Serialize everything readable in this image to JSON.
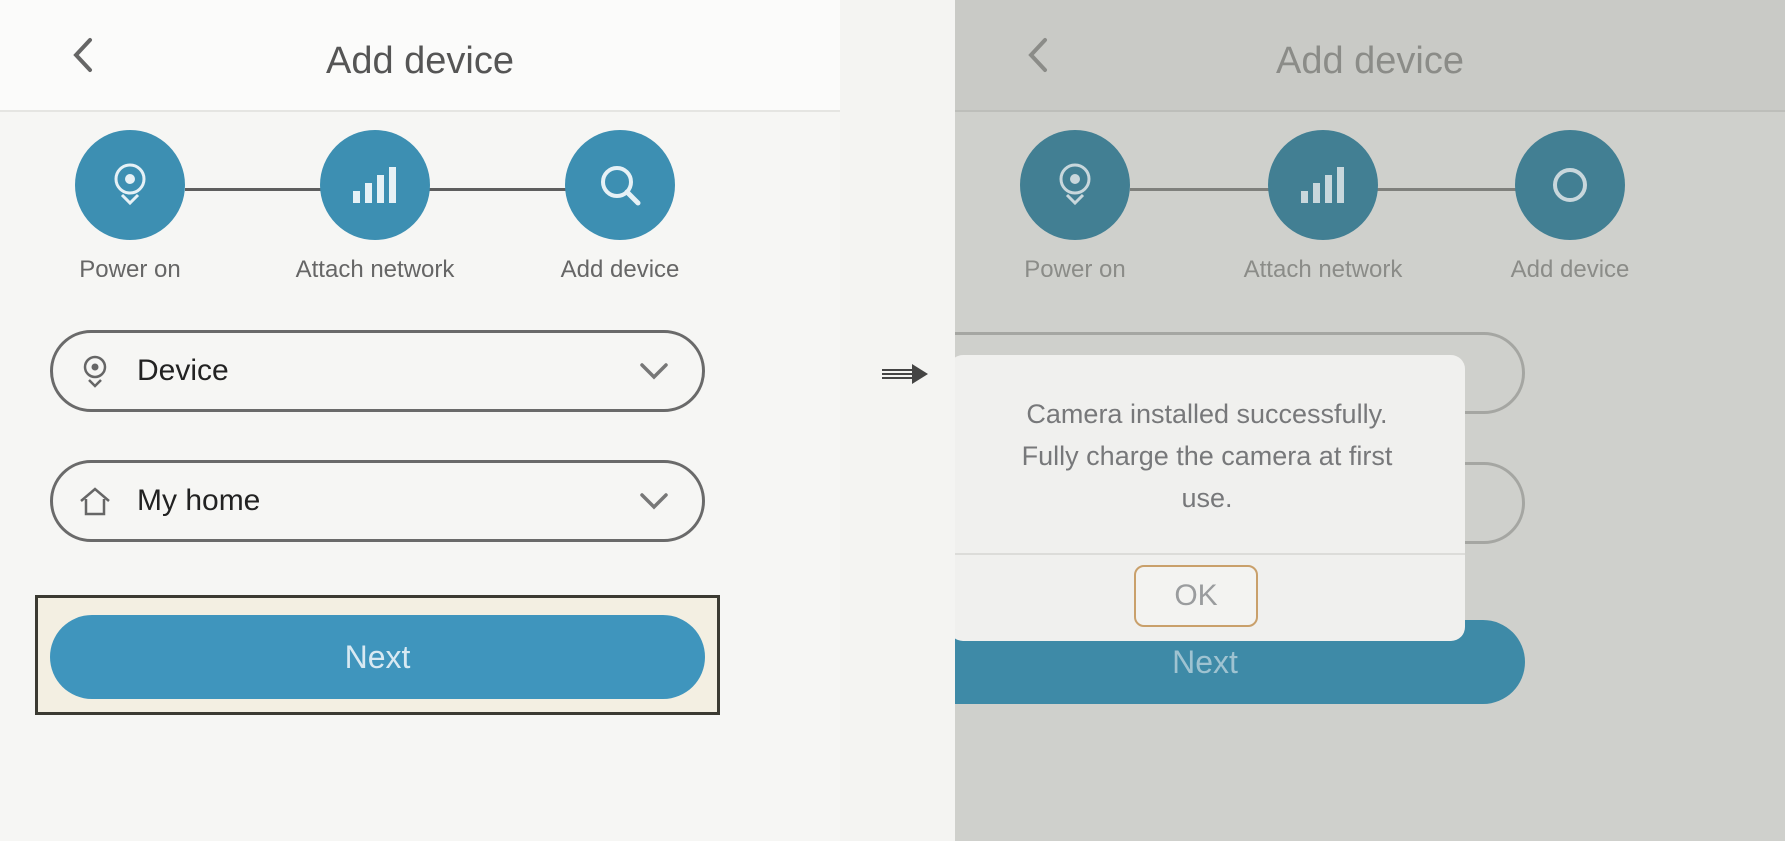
{
  "screens": [
    {
      "title": "Add device",
      "steps": [
        {
          "label": "Power on",
          "icon": "camera-icon"
        },
        {
          "label": "Attach network",
          "icon": "wifi-signal-icon"
        },
        {
          "label": "Add device",
          "icon": "search-icon"
        }
      ],
      "device_select": {
        "value": "Device",
        "icon": "camera-icon"
      },
      "home_select": {
        "value": "My home",
        "icon": "home-icon"
      },
      "next_label": "Next"
    },
    {
      "title": "Add device",
      "steps": [
        {
          "label": "Power on",
          "icon": "camera-icon"
        },
        {
          "label": "Attach network",
          "icon": "wifi-signal-icon"
        },
        {
          "label": "Add device",
          "icon": "search-icon"
        }
      ],
      "next_label": "Next",
      "dialog": {
        "line1": "Camera installed successfully.",
        "line2": "Fully charge the camera at first",
        "line3": "use.",
        "ok_label": "OK"
      }
    }
  ],
  "colors": {
    "accent": "#3d8fb2",
    "ok_border": "#c9a06b"
  }
}
